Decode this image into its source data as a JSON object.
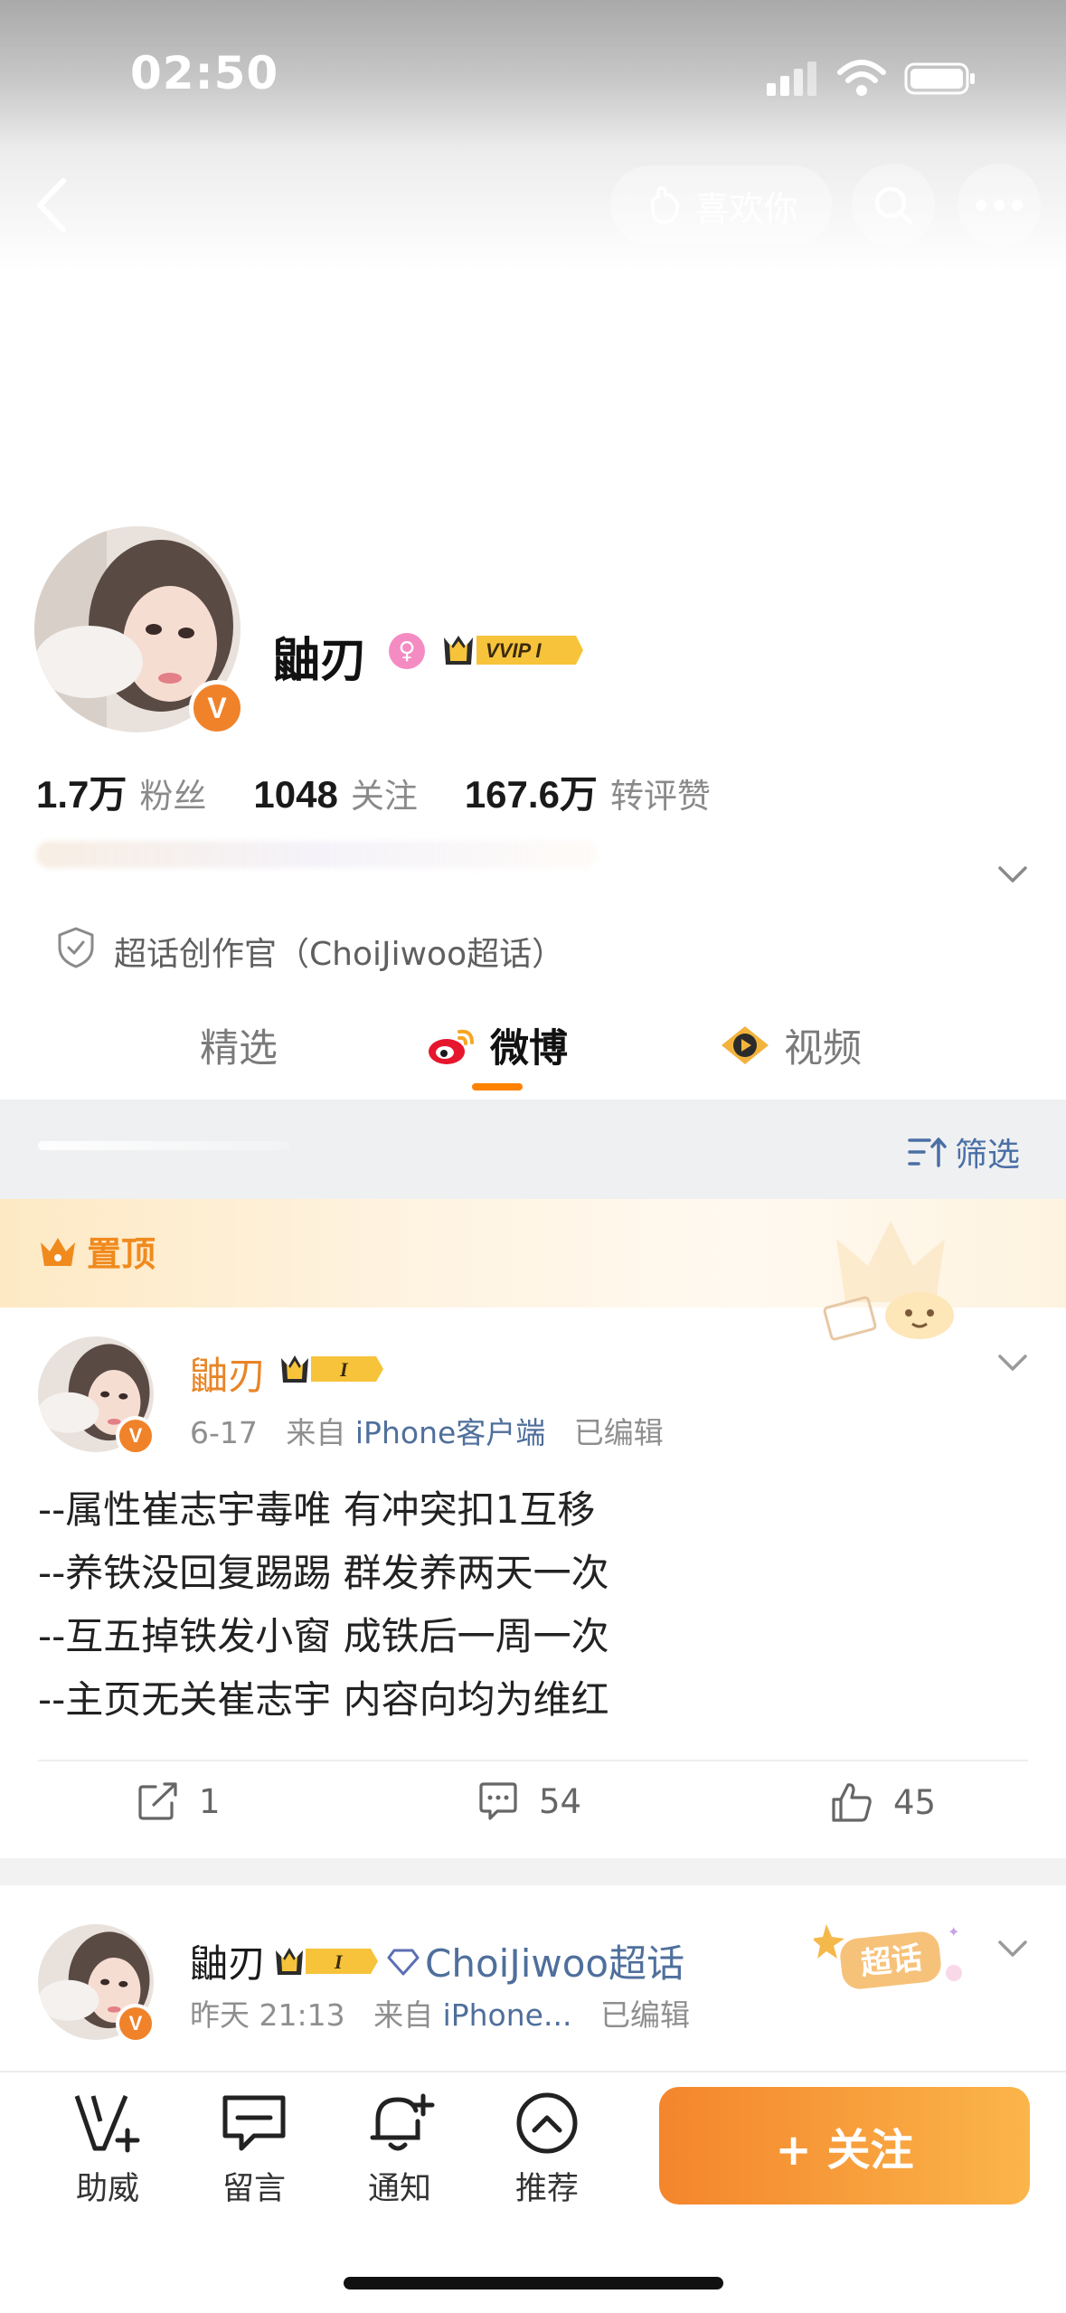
{
  "status_bar": {
    "time": "02:50"
  },
  "header": {
    "like_label": "喜欢你"
  },
  "profile": {
    "name": "鼬刃",
    "vip_badge": "VVIP I",
    "stats": [
      {
        "value": "1.7万",
        "label": "粉丝"
      },
      {
        "value": "1048",
        "label": "关注"
      },
      {
        "value": "167.6万",
        "label": "转评赞"
      }
    ],
    "role": "超话创作官（ChoiJiwoo超话）"
  },
  "tabs": [
    {
      "label": "精选",
      "active": false
    },
    {
      "label": "微博",
      "active": true
    },
    {
      "label": "视频",
      "active": false
    }
  ],
  "filter": {
    "label": "筛选"
  },
  "pinned_post": {
    "pin_label": "置顶",
    "author": "鼬刃",
    "badge": "I",
    "date": "6-17",
    "from_prefix": "来自",
    "source": "iPhone客户端",
    "edited": "已编辑",
    "lines": [
      "--属性崔志宇毒唯 有冲突扣1互移",
      "--养铁没回复踢踢 群发养两天一次",
      "--互五掉铁发小窗 成铁后一周一次",
      "--主页无关崔志宇 内容向均为维红"
    ],
    "reposts": "1",
    "comments": "54",
    "likes": "45"
  },
  "second_post": {
    "author": "鼬刃",
    "badge": "I",
    "topic": "ChoiJiwoo超话",
    "date": "昨天 21:13",
    "from_prefix": "来自",
    "source": "iPhone...",
    "edited": "已编辑",
    "topic_tag": "超话"
  },
  "bottom_nav": {
    "items": [
      {
        "label": "助威",
        "icon": "v-plus-icon"
      },
      {
        "label": "留言",
        "icon": "chat-icon"
      },
      {
        "label": "通知",
        "icon": "bell-icon"
      },
      {
        "label": "推荐",
        "icon": "chevron-up-circle-icon"
      }
    ],
    "follow_label": "+ 关注"
  },
  "colors": {
    "accent": "#ff8200",
    "link": "#4f6f9c",
    "name": "#e88527"
  }
}
